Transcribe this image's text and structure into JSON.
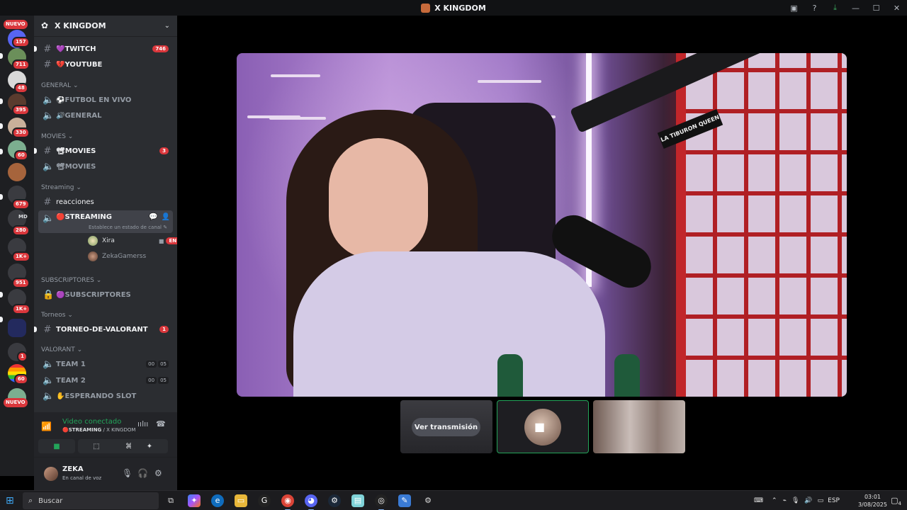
{
  "window": {
    "title": "X KINGDOM"
  },
  "rail": {
    "nuevo_top": "NUEVO",
    "nuevo_bottom": "NUEVO",
    "badges": [
      "157",
      "711",
      "48",
      "395",
      "330",
      "60",
      "679",
      "280",
      "1K+",
      "951",
      "1K+",
      "1",
      "60"
    ],
    "dm_label": "MD"
  },
  "server": {
    "name": "X KINGDOM"
  },
  "channels": {
    "twitch": {
      "name": "💜TWITCH",
      "count": "746"
    },
    "youtube": {
      "name": "💔YOUTUBE"
    },
    "cat_general": "GENERAL",
    "futbol": {
      "name": "⚽FUTBOL EN VIVO"
    },
    "general": {
      "name": "🔊GENERAL"
    },
    "cat_movies": "MOVIES",
    "movies_text": {
      "name": "📽MOVIES",
      "count": "3"
    },
    "movies_voice": {
      "name": "📽MOVIES"
    },
    "cat_streaming": "Streaming",
    "reacciones": {
      "name": "reacciones"
    },
    "streaming": {
      "name": "🔴STREAMING",
      "status": "Establece un estado de canal"
    },
    "voice_users": [
      {
        "name": "Xira",
        "live": "EN DIRECTO"
      },
      {
        "name": "ZekaGamerss"
      }
    ],
    "cat_subs": "SUBSCRIPTORES",
    "subscriptores": {
      "name": "🟣SUBSCRIPTORES"
    },
    "cat_torneos": "Torneos",
    "torneo": {
      "name": "TORNEO-DE-VALORANT",
      "count": "1"
    },
    "cat_valorant": "VALORANT",
    "team1": {
      "name": "TEAM 1",
      "a": "00",
      "b": "05"
    },
    "team2": {
      "name": "TEAM 2",
      "a": "00",
      "b": "05"
    },
    "esperando": {
      "name": "✋ESPERANDO SLOT"
    }
  },
  "voice_panel": {
    "status": "Video conectado",
    "channel": "🔴STREAMING",
    "server": " / X KINGDOM"
  },
  "user": {
    "name": "ZEKA",
    "status": "En canal de voz"
  },
  "stage": {
    "watch_label": "Ver transmisión",
    "video_sign": "LA TIBURON QUEEN"
  },
  "taskbar": {
    "search_placeholder": "Buscar",
    "lang": "ESP",
    "time": "03:01",
    "date": "3/08/2025",
    "notif_count": "4"
  },
  "colors": {
    "accent_green": "#23a55a",
    "badge_red": "#da373c",
    "sidebar_bg": "#2b2d31"
  }
}
